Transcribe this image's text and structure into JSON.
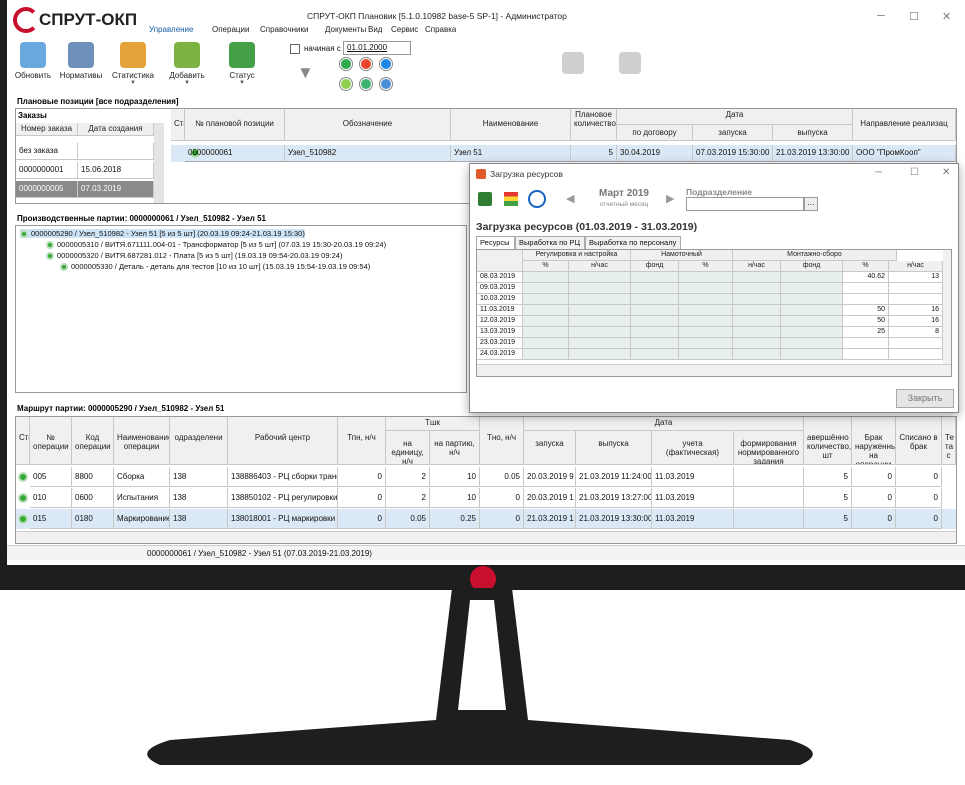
{
  "app": {
    "logo_text": "СПРУТ-ОКП",
    "window_title": "СПРУТ-ОКП Плановик [5.1.0.10982 base-5 SP-1] - Администратор",
    "menu": [
      "Управление",
      "Операции",
      "Справочники",
      "Документы",
      "Вид",
      "Сервис",
      "Справка"
    ],
    "active_menu_index": 0
  },
  "ribbon": {
    "buttons": [
      {
        "label": "Обновить",
        "icon": "refresh-icon"
      },
      {
        "label": "Нормативы",
        "icon": "calculator-icon"
      },
      {
        "label": "Статистика",
        "icon": "bar-chart-icon"
      },
      {
        "label": "Добавить",
        "icon": "add-table-icon"
      },
      {
        "label": "Статус",
        "icon": "flag-icon"
      }
    ],
    "start_checkbox_label": "начиная с",
    "start_date": "01.01.2000",
    "status_colors": [
      "#2fa84f",
      "#e8472a",
      "#1e88e5",
      "#8fd14f",
      "#3cb371",
      "#4a90d9"
    ]
  },
  "planned": {
    "title": "Плановые позиции [все подразделения]",
    "orders_title": "Заказы",
    "orders_headers": [
      "Номер заказа",
      "Дата создания"
    ],
    "orders": [
      {
        "num": "без заказа",
        "date": ""
      },
      {
        "num": "0000000001",
        "date": "15.06.2018"
      },
      {
        "num": "0000000005",
        "date": "07.03.2019"
      }
    ],
    "headers": {
      "status": "Статус",
      "pos": "№ плановой позиции",
      "designation": "Обозначение",
      "name": "Наименование",
      "qty": "Плановое количество",
      "date_group": "Дата",
      "by_contract": "по договору",
      "start": "запуска",
      "release": "выпуска",
      "direction": "Направление реализац"
    },
    "row": {
      "pos": "0000000061",
      "designation": "Узел_510982",
      "name": "Узел 51",
      "qty": "5",
      "by_contract": "30.04.2019",
      "start": "07.03.2019 15:30:00",
      "release": "21.03.2019 13:30:00",
      "direction": "ООО \"ПромКооп\""
    }
  },
  "batches": {
    "title": "Производственные партии: 0000000061 / Узел_510982 - Узел 51",
    "tree": [
      "0000005290 / Узел_510982 - Узел 51 [5 из 5 шт] (20.03.19 09:24-21.03.19 15:30)",
      "0000005310 / ВИТЯ.671111.004-01 - Трансформатор [5 из 5 шт] (07.03.19 15:30-20.03.19 09:24)",
      "0000005320 / ВИТЯ.687281.012 - Плата [5 из 5 шт] (19.03.19 09:54-20.03.19 09:24)",
      "0000005330 / Деталь - деталь для тестов [10 из 10 шт] (15.03.19 15:54-19.03.19 09:54)"
    ]
  },
  "route": {
    "title": "Маршрут партии: 0000005290 / Узел_510982 - Узел 51",
    "headers": {
      "status": "Статус",
      "op_num": "№ операции",
      "code": "Код операции",
      "op_name": "Наименование операции",
      "dept": "одразделени",
      "wc": "Рабочий центр",
      "tpn": "Тпн, н/ч",
      "tshk": "Тшк",
      "per_unit": "на единицу, н/ч",
      "per_batch": "на партию, н/ч",
      "tno": "Тно, н/ч",
      "date_group": "Дата",
      "start": "запуска",
      "release": "выпуска",
      "fact": "учета (фактическая)",
      "norm": "формирования нормированного задания",
      "done": "авершённо количество, шт",
      "defect": "Брак наруженны на операции",
      "writeoff": "Списано в брак",
      "extra": "Те та с"
    },
    "rows": [
      {
        "op": "005",
        "code": "8800",
        "name": "Сборка",
        "dept": "138",
        "wc": "138886403 - РЦ сборки трансф",
        "tpn": "0",
        "unit": "2",
        "batch": "10",
        "tno": "0.05",
        "start": "20.03.2019 9",
        "release": "21.03.2019 11:24:00",
        "fact": "11.03.2019",
        "done": "5",
        "defect": "0",
        "writeoff": "0"
      },
      {
        "op": "010",
        "code": "0600",
        "name": "Испытания",
        "dept": "138",
        "wc": "138850102 - РЦ регулировки с",
        "tpn": "0",
        "unit": "2",
        "batch": "10",
        "tno": "0",
        "start": "20.03.2019 1",
        "release": "21.03.2019 13:27:00",
        "fact": "11.03.2019",
        "done": "5",
        "defect": "0",
        "writeoff": "0"
      },
      {
        "op": "015",
        "code": "0180",
        "name": "Маркирование",
        "dept": "138",
        "wc": "138018001 - РЦ маркировки из",
        "tpn": "0",
        "unit": "0.05",
        "batch": "0.25",
        "tno": "0",
        "start": "21.03.2019 1",
        "release": "21.03.2019 13:30:00",
        "fact": "11.03.2019",
        "done": "5",
        "defect": "0",
        "writeoff": "0"
      }
    ]
  },
  "statusbar": {
    "text": "0000000061 / Узел_510982 - Узел 51 (07.03.2019-21.03.2019)"
  },
  "dialog": {
    "title": "Загрузка ресурсов",
    "month": "Март 2019",
    "month_sub": "отчетный месяц",
    "dept_label": "Подразделение",
    "dept_value": "",
    "heading": "Загрузка ресурсов (01.03.2019 - 31.03.2019)",
    "tabs": [
      "Ресурсы",
      "Выработка по РЦ",
      "Выработка по персоналу"
    ],
    "groups": [
      "Регулировка и настройка",
      "Намоточный",
      "Монтажно-сборо"
    ],
    "subcols": [
      "%",
      "н/час",
      "фонд",
      "%",
      "н/час",
      "фонд",
      "%",
      "н/час"
    ],
    "rows": [
      {
        "date": "08.03.2019",
        "v1": "40.62",
        "v2": "13"
      },
      {
        "date": "09.03.2019",
        "v1": "",
        "v2": ""
      },
      {
        "date": "10.03.2019",
        "v1": "",
        "v2": ""
      },
      {
        "date": "11.03.2019",
        "v1": "50",
        "v2": "16"
      },
      {
        "date": "12.03.2019",
        "v1": "50",
        "v2": "16"
      },
      {
        "date": "13.03.2019",
        "v1": "25",
        "v2": "8"
      },
      {
        "date": "23.03.2019",
        "v1": "",
        "v2": ""
      },
      {
        "date": "24.03.2019",
        "v1": "",
        "v2": ""
      }
    ],
    "close_label": "Закрыть"
  }
}
